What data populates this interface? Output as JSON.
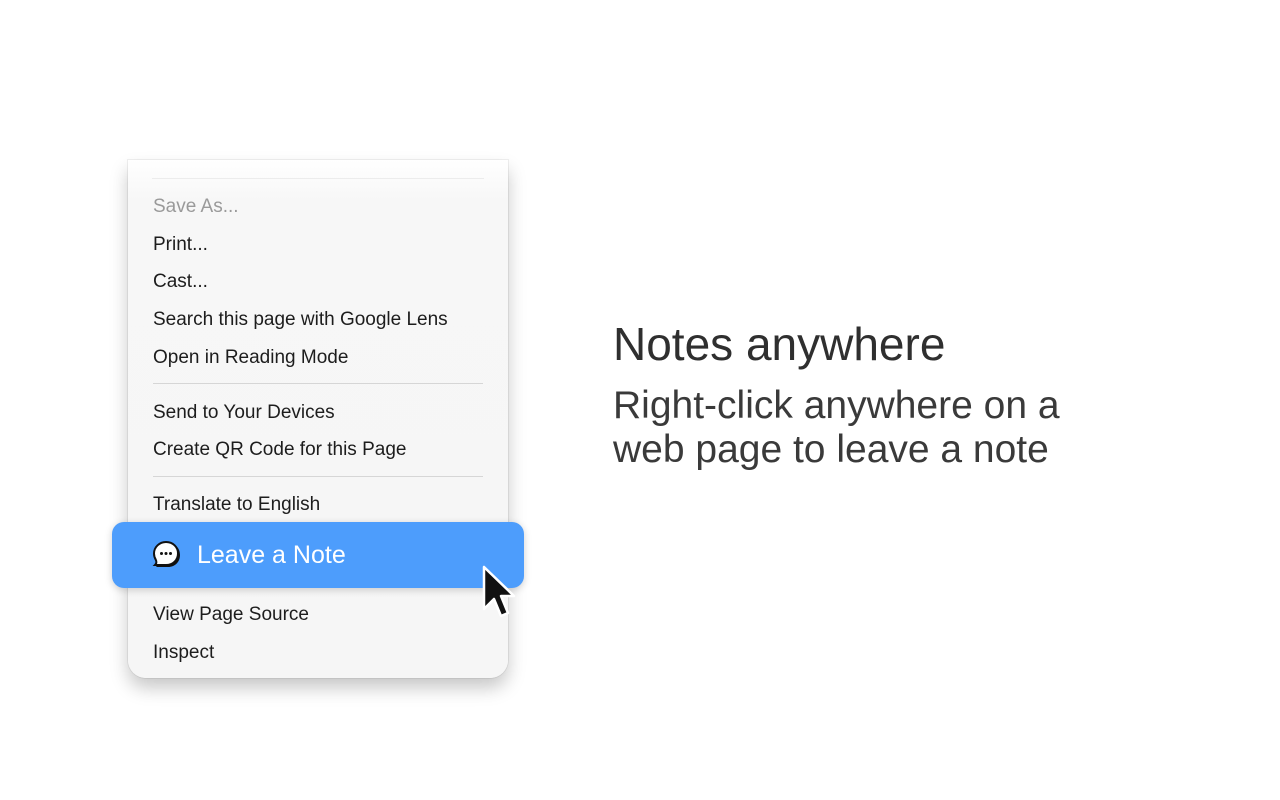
{
  "menu": {
    "items_group1": [
      {
        "label": "Save As...",
        "disabled": true
      },
      {
        "label": "Print...",
        "disabled": false
      },
      {
        "label": "Cast...",
        "disabled": false
      },
      {
        "label": "Search this page with Google Lens",
        "disabled": false
      },
      {
        "label": "Open in Reading Mode",
        "disabled": false
      }
    ],
    "items_group2": [
      {
        "label": "Send to Your Devices"
      },
      {
        "label": "Create QR Code for this Page"
      }
    ],
    "items_group3": [
      {
        "label": "Translate to English"
      }
    ],
    "highlighted_item": {
      "label": "Leave a Note",
      "icon": "speech-bubble-icon",
      "color": "#4d9dfc"
    },
    "items_group4": [
      {
        "label": "View Page Source"
      },
      {
        "label": "Inspect"
      }
    ]
  },
  "promo": {
    "headline": "Notes anywhere",
    "subline": "Right-click anywhere on a web page to leave a note"
  },
  "cursor": {
    "icon": "mouse-pointer-icon"
  }
}
